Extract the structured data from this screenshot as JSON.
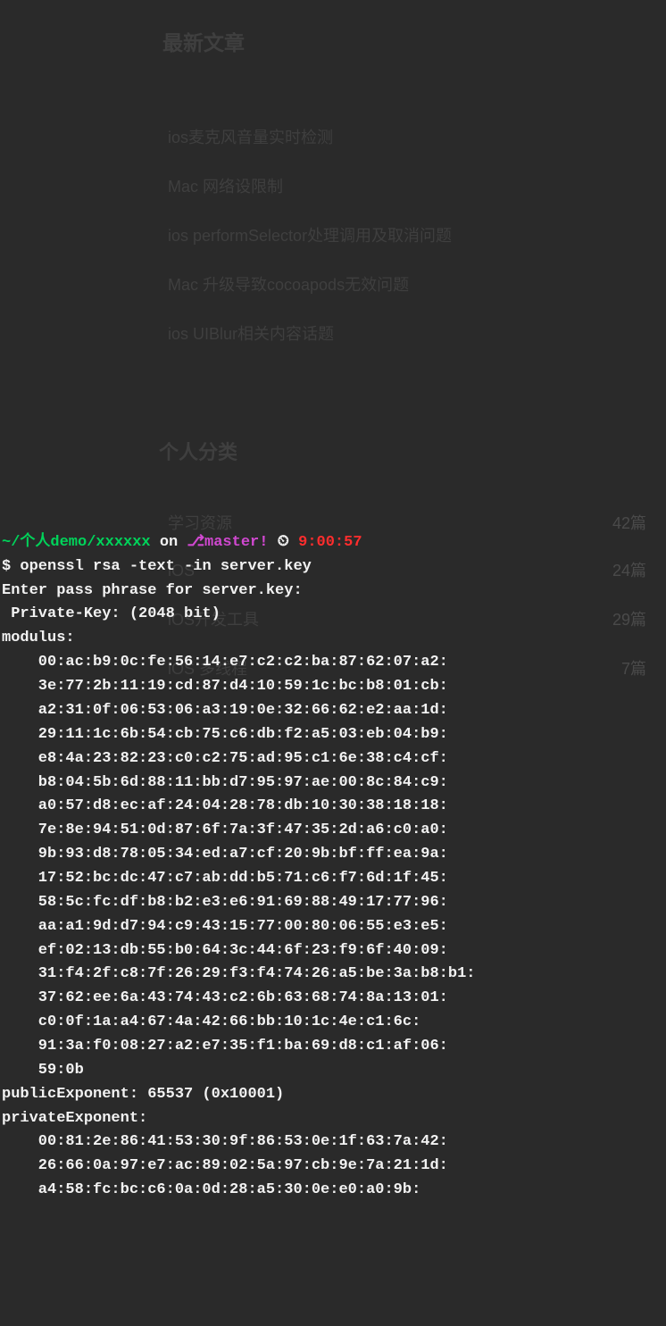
{
  "prompt": {
    "path_prefix": "~/个人demo/xxxxxx",
    "on": " on ",
    "branch_icon": "⎇",
    "branch": "master",
    "bang": "!",
    "clock_icon": " ⏲ ",
    "time": "9:00:57"
  },
  "cmd": {
    "prompt_char": "$ ",
    "command": "openssl rsa -text -in server.key"
  },
  "out": {
    "enter_pass": "Enter pass phrase for server.key:",
    "private_key": " Private-Key: (2048 bit)",
    "modulus_label": "modulus:",
    "mod_lines": [
      "    00:ac:b9:0c:fe:56:14:e7:c2:c2:ba:87:62:07:a2:",
      "    3e:77:2b:11:19:cd:87:d4:10:59:1c:bc:b8:01:cb:",
      "    a2:31:0f:06:53:06:a3:19:0e:32:66:62:e2:aa:1d:",
      "    29:11:1c:6b:54:cb:75:c6:db:f2:a5:03:eb:04:b9:",
      "    e8:4a:23:82:23:c0:c2:75:ad:95:c1:6e:38:c4:cf:",
      "    b8:04:5b:6d:88:11:bb:d7:95:97:ae:00:8c:84:c9:",
      "    a0:57:d8:ec:af:24:04:28:78:db:10:30:38:18:18:",
      "    7e:8e:94:51:0d:87:6f:7a:3f:47:35:2d:a6:c0:a0:",
      "    9b:93:d8:78:05:34:ed:a7:cf:20:9b:bf:ff:ea:9a:",
      "    17:52:bc:dc:47:c7:ab:dd:b5:71:c6:f7:6d:1f:45:",
      "    58:5c:fc:df:b8:b2:e3:e6:91:69:88:49:17:77:96:",
      "    aa:a1:9d:d7:94:c9:43:15:77:00:80:06:55:e3:e5:",
      "    ef:02:13:db:55:b0:64:3c:44:6f:23:f9:6f:40:09:",
      "    31:f4:2f:c8:7f:26:29:f3:f4:74:26:a5:be:3a:b8:b1:",
      "    37:62:ee:6a:43:74:43:c2:6b:63:68:74:8a:13:01:",
      "    c0:0f:1a:a4:67:4a:42:66:bb:10:1c:4e:c1:6c:",
      "    91:3a:f0:08:27:a2:e7:35:f1:ba:69:d8:c1:af:06:",
      "    59:0b"
    ],
    "pub_exp": "publicExponent: 65537 (0x10001)",
    "priv_exp_label": "privateExponent:",
    "priv_lines": [
      "    00:81:2e:86:41:53:30:9f:86:53:0e:1f:63:7a:42:",
      "    26:66:0a:97:e7:ac:89:02:5a:97:cb:9e:7a:21:1d:",
      "    a4:58:fc:bc:c6:0a:0d:28:a5:30:0e:e0:a0:9b:"
    ]
  },
  "ghost": {
    "title": "最新文章",
    "items": [
      "ios麦克风音量实时检测",
      "Mac 网络设限制",
      "ios performSelector处理调用及取消问题",
      "Mac 升级导致cocoapods无效问题",
      "ios UIBlur相关内容话题"
    ],
    "section": "个人分类",
    "cats": [
      {
        "name": "学习资源",
        "count": "42篇"
      },
      {
        "name": "iOS",
        "count": "24篇"
      },
      {
        "name": "iOS开发工具",
        "count": "29篇"
      },
      {
        "name": "iOS 多线程",
        "count": "7篇"
      }
    ]
  }
}
